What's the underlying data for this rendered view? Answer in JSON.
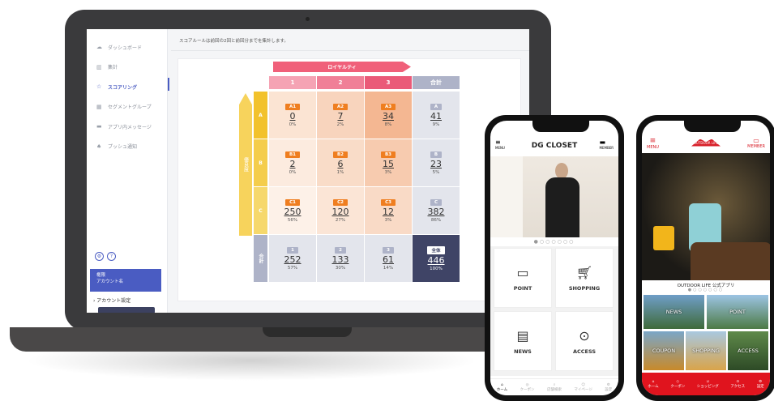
{
  "dashboard": {
    "top_note": "スコアルールは前回の2回と前回分までを集計します。",
    "nav": [
      {
        "label": "ダッシュボード",
        "icon": "cloud-icon"
      },
      {
        "label": "集計",
        "icon": "bar-chart-icon"
      },
      {
        "label": "スコアリング",
        "icon": "star-icon"
      },
      {
        "label": "セグメントグループ",
        "icon": "grid-icon"
      },
      {
        "label": "アプリ内メッセージ",
        "icon": "message-icon"
      },
      {
        "label": "プッシュ通知",
        "icon": "bell-icon"
      }
    ],
    "account_label": "権限",
    "account_name": "アカウント名",
    "account_settings": "› アカウント設定",
    "loyalty_label": "ロイヤルティ",
    "vertical_label": "優良度",
    "columns": [
      "1",
      "2",
      "3",
      "合計"
    ],
    "rows": [
      "A",
      "B",
      "C",
      "合計"
    ],
    "cells": [
      [
        {
          "code": "A1",
          "value": "0",
          "pct": "0%"
        },
        {
          "code": "A2",
          "value": "7",
          "pct": "2%"
        },
        {
          "code": "A3",
          "value": "34",
          "pct": "8%"
        },
        {
          "code": "A",
          "value": "41",
          "pct": "9%"
        }
      ],
      [
        {
          "code": "B1",
          "value": "2",
          "pct": "0%"
        },
        {
          "code": "B2",
          "value": "6",
          "pct": "1%"
        },
        {
          "code": "B3",
          "value": "15",
          "pct": "3%"
        },
        {
          "code": "B",
          "value": "23",
          "pct": "5%"
        }
      ],
      [
        {
          "code": "C1",
          "value": "250",
          "pct": "56%"
        },
        {
          "code": "C2",
          "value": "120",
          "pct": "27%"
        },
        {
          "code": "C3",
          "value": "12",
          "pct": "3%"
        },
        {
          "code": "C",
          "value": "382",
          "pct": "86%"
        }
      ],
      [
        {
          "code": "1",
          "value": "252",
          "pct": "57%"
        },
        {
          "code": "2",
          "value": "133",
          "pct": "30%"
        },
        {
          "code": "3",
          "value": "61",
          "pct": "14%"
        },
        {
          "code": "全体",
          "value": "446",
          "pct": "100%"
        }
      ]
    ]
  },
  "phone1": {
    "menu": "MENU",
    "title": "DG CLOSET",
    "member": "MEMBER",
    "tiles": [
      "POINT",
      "SHOPPING",
      "NEWS",
      "ACCESS"
    ],
    "tabs": [
      "ホーム",
      "クーポン",
      "店舗検索",
      "マイページ",
      "設定"
    ]
  },
  "phone2": {
    "menu": "MENU",
    "member": "MEMBER",
    "logo": "OUTDOOR LIFE",
    "app_title": "OUTDOOR LIFE 公式アプリ",
    "tiles": [
      "NEWS",
      "POINT",
      "COUPON",
      "SHOPPING",
      "ACCESS"
    ],
    "tabs": [
      "ホーム",
      "クーポン",
      "ショッピング",
      "アクセス",
      "設定"
    ]
  }
}
